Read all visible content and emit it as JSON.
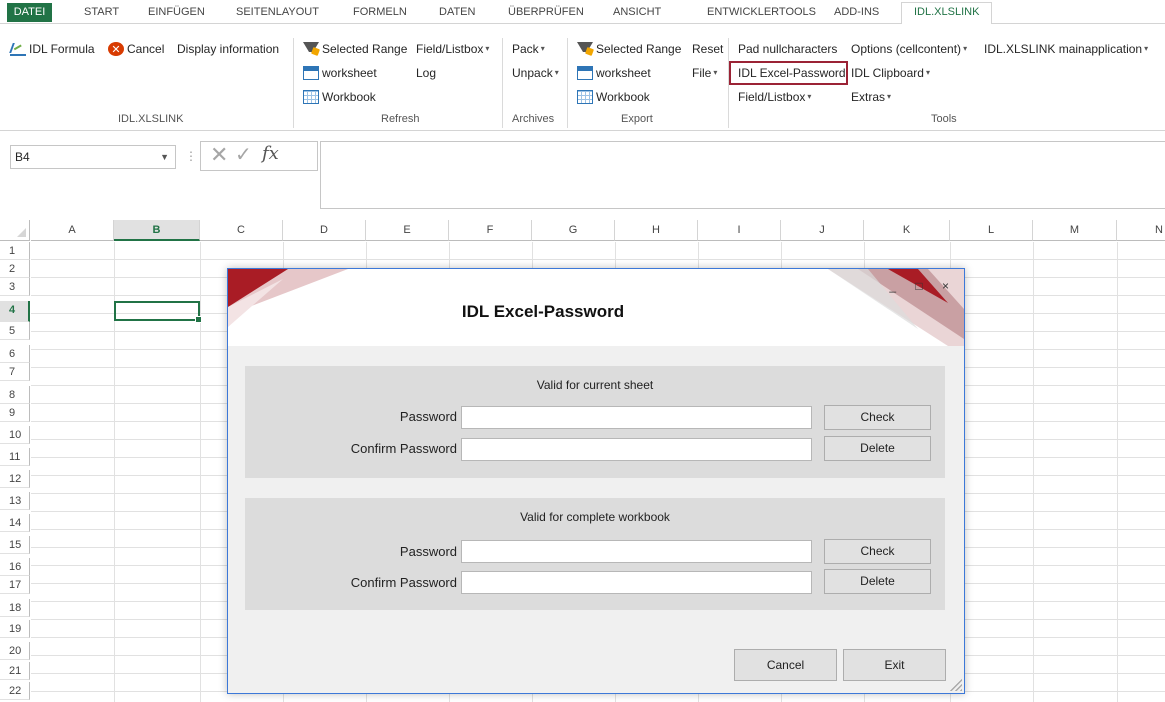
{
  "ribbon_tabs": [
    {
      "label": "DATEI"
    },
    {
      "label": "START"
    },
    {
      "label": "EINFÜGEN"
    },
    {
      "label": "SEITENLAYOUT"
    },
    {
      "label": "FORMELN"
    },
    {
      "label": "DATEN"
    },
    {
      "label": "ÜBERPRÜFEN"
    },
    {
      "label": "ANSICHT"
    },
    {
      "label": "ENTWICKLERTOOLS"
    },
    {
      "label": "ADD-INS"
    },
    {
      "label": "IDL.XLSLINK"
    }
  ],
  "active_tab": "IDL.XLSLINK",
  "colors": {
    "excel_green": "#217346",
    "highlight_red": "#9b2335",
    "dialog_accent": "#8b1a1f"
  },
  "ribbon": {
    "group_idlxlslink": {
      "label": "IDL.XLSLINK",
      "idl_formula": "IDL Formula",
      "cancel": "Cancel",
      "display_information": "Display information"
    },
    "group_refresh": {
      "label": "Refresh",
      "selected_range": "Selected Range",
      "field_listbox": "Field/Listbox",
      "worksheet": "worksheet",
      "log": "Log",
      "workbook": "Workbook"
    },
    "group_archives": {
      "label": "Archives",
      "pack": "Pack",
      "unpack": "Unpack"
    },
    "group_export": {
      "label": "Export",
      "selected_range": "Selected Range",
      "reset": "Reset",
      "worksheet": "worksheet",
      "file": "File",
      "workbook": "Workbook"
    },
    "group_tools": {
      "label": "Tools",
      "pad_nullcharacters": "Pad nullcharacters",
      "options_cellcontent": "Options (cellcontent)",
      "mainapplication": "IDL.XLSLINK mainapplication",
      "excel_password": "IDL Excel-Password",
      "clipboard": "IDL Clipboard",
      "field_listbox": "Field/Listbox",
      "extras": "Extras"
    }
  },
  "formula_bar": {
    "name_box": "B4",
    "fx": "fx",
    "formula": ""
  },
  "sheet": {
    "columns": [
      "A",
      "B",
      "C",
      "D",
      "E",
      "F",
      "G",
      "H",
      "I",
      "J",
      "K",
      "L",
      "M",
      "N"
    ],
    "rows": [
      "1",
      "2",
      "3",
      "4",
      "5",
      "6",
      "7",
      "8",
      "9",
      "10",
      "11",
      "12",
      "13",
      "14",
      "15",
      "16",
      "17",
      "18",
      "19",
      "20",
      "21",
      "22"
    ],
    "selected_column": "B",
    "selected_row": "4"
  },
  "dialog": {
    "title": "IDL Excel-Password",
    "window_buttons": "_ □ ×",
    "sheet_section": {
      "title": "Valid for current sheet",
      "password_label": "Password",
      "password_value": "",
      "confirm_label": "Confirm Password",
      "confirm_value": "",
      "check_label": "Check",
      "delete_label": "Delete"
    },
    "workbook_section": {
      "title": "Valid for complete workbook",
      "password_label": "Password",
      "password_value": "",
      "confirm_label": "Confirm Password",
      "confirm_value": "",
      "check_label": "Check",
      "delete_label": "Delete"
    },
    "cancel_label": "Cancel",
    "exit_label": "Exit"
  }
}
